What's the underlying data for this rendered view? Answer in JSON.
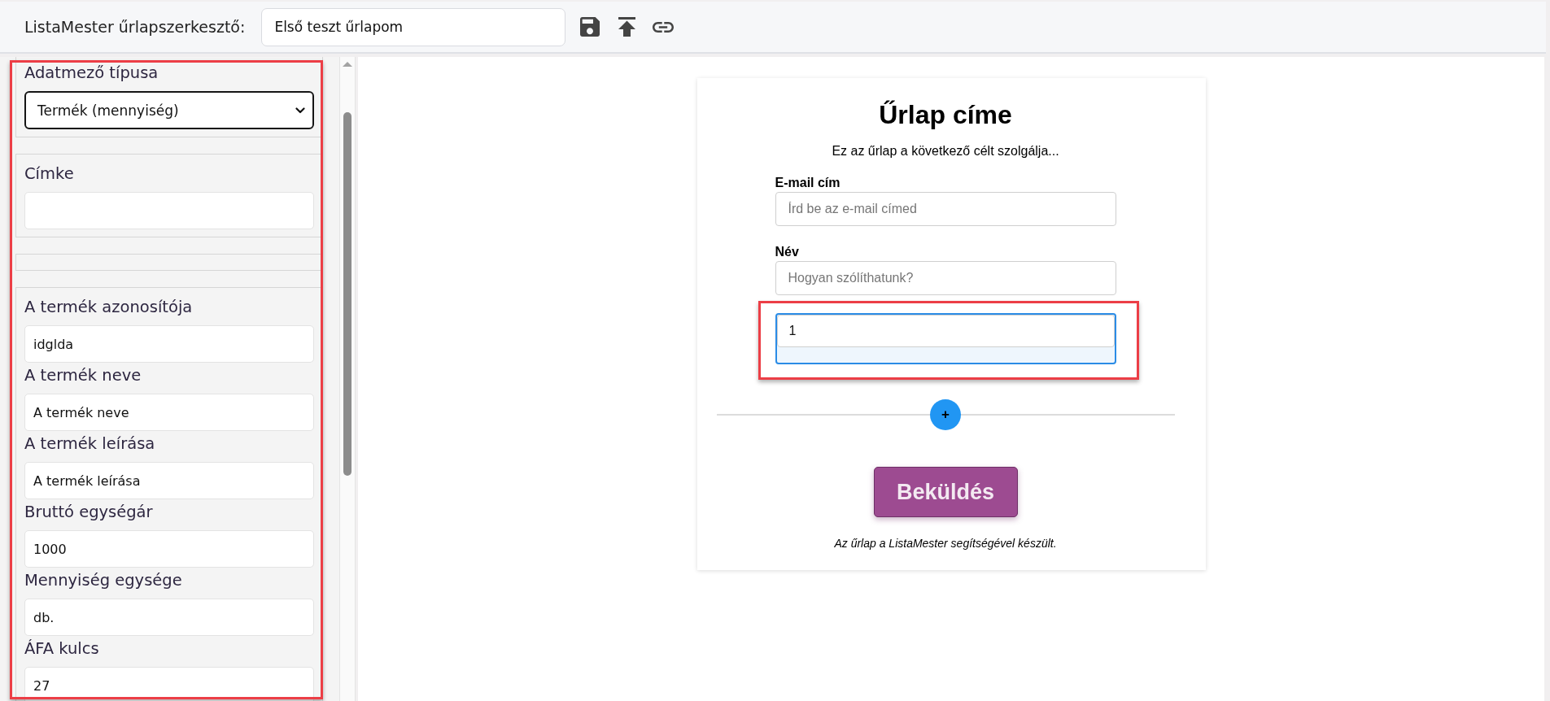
{
  "header": {
    "title": "ListaMester űrlapszerkesztő:",
    "form_name": "Első teszt űrlapom"
  },
  "properties_panel": {
    "highlighted": true,
    "sections": [
      {
        "kind": "fields",
        "fields": [
          {
            "kind": "select",
            "label": "Adatmező típusa",
            "value": "Termék (mennyiség)"
          }
        ]
      },
      {
        "kind": "fields",
        "fields": [
          {
            "kind": "input",
            "label": "Címke"
          }
        ]
      },
      {
        "kind": "blank"
      },
      {
        "kind": "fields",
        "fields": [
          {
            "kind": "input",
            "label": "A termék azonosítója",
            "value": "idglda"
          },
          {
            "kind": "input",
            "label": "A termék neve",
            "value": "A termék neve"
          },
          {
            "kind": "input",
            "label": "A termék leírása",
            "value": "A termék leírása"
          },
          {
            "kind": "input",
            "label": "Bruttó egységár",
            "value": "1000"
          },
          {
            "kind": "input",
            "label": "Mennyiség egysége",
            "value": "db."
          },
          {
            "kind": "input",
            "label": "ÁFA kulcs",
            "value": "27"
          }
        ]
      }
    ]
  },
  "form_preview": {
    "title": "Űrlap címe",
    "description": "Ez az űrlap a következő célt szolgálja...",
    "fields": [
      {
        "kind": "text",
        "label": "E-mail cím",
        "placeholder": "Írd be az e-mail címed",
        "selected": false
      },
      {
        "kind": "text",
        "label": "Név",
        "placeholder": "Hogyan szólíthatunk?",
        "selected": false
      },
      {
        "kind": "quantity",
        "value": "1",
        "selected": true,
        "highlighted": true
      }
    ],
    "add_button": "+",
    "submit_button": "Beküldés",
    "footer": "Az űrlap a ListaMester segítségével készült."
  }
}
